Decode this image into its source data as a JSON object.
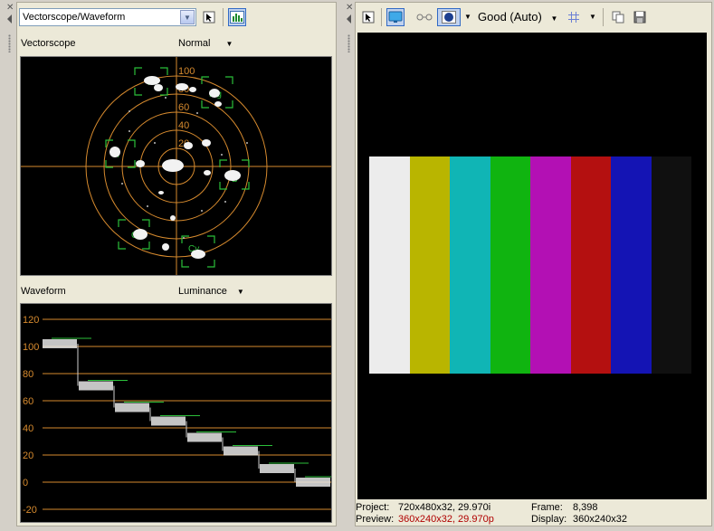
{
  "left": {
    "scope_select": "Vectorscope/Waveform",
    "vectorscope": {
      "label": "Vectorscope",
      "mode": "Normal",
      "ring_labels": [
        "100",
        "80",
        "60",
        "40",
        "20"
      ],
      "target_labels": [
        "R",
        "Mg",
        "Yl",
        "B",
        "G",
        "Cy"
      ]
    },
    "waveform": {
      "label": "Waveform",
      "mode": "Luminance",
      "scale": [
        "120",
        "100",
        "80",
        "60",
        "40",
        "20",
        "0",
        "-20"
      ],
      "steps": [
        102,
        71,
        55,
        45,
        33,
        23,
        10,
        0
      ]
    }
  },
  "right": {
    "quality": "Good (Auto)",
    "color_bars": [
      "#ececec",
      "#b9b500",
      "#10b5b5",
      "#10b410",
      "#b310b4",
      "#b41010",
      "#1414b4",
      "#101010"
    ],
    "status": {
      "project_label": "Project:",
      "project_value": "720x480x32, 29.970i",
      "preview_label": "Preview:",
      "preview_value": "360x240x32, 29.970p",
      "frame_label": "Frame:",
      "frame_value": "8,398",
      "display_label": "Display:",
      "display_value": "360x240x32"
    }
  }
}
